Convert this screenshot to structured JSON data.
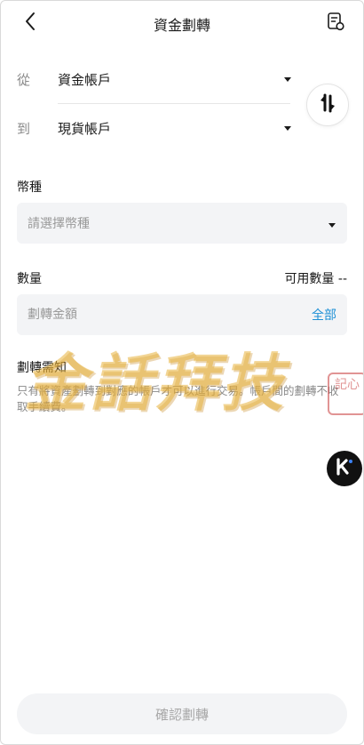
{
  "header": {
    "title": "資金劃轉"
  },
  "transfer": {
    "from_label": "從",
    "from_account": "資金帳戶",
    "to_label": "到",
    "to_account": "現貨帳戶"
  },
  "currency": {
    "label": "幣種",
    "placeholder": "請選擇幣種"
  },
  "amount": {
    "label": "數量",
    "available": "可用數量 --",
    "placeholder": "劃轉金額",
    "all_label": "全部"
  },
  "notice": {
    "title": "劃轉需知",
    "text": "只有將資產劃轉到對應的帳戶才可以進行交易。帳戶間的劃轉不收取手續費。"
  },
  "watermark": {
    "text": "金話拜技",
    "seal_text": "記心"
  },
  "confirm": {
    "label": "確認劃轉"
  },
  "icons": {
    "back": "chevron-left-icon",
    "history": "record-icon",
    "swap": "swap-vertical-icon",
    "caret": "caret-down-icon",
    "float_logo": "k-logo-icon"
  },
  "colors": {
    "accent": "#1e90d6",
    "input_bg": "#f3f4f6",
    "muted_text": "#8a8a8a"
  }
}
